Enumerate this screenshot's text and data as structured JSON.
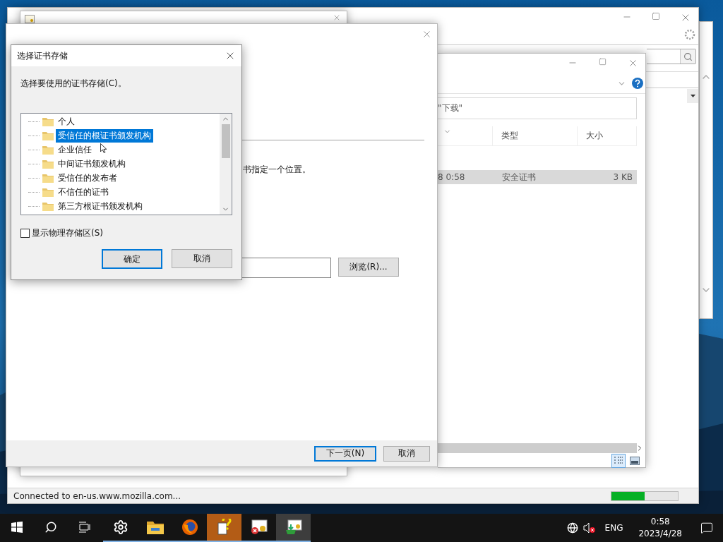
{
  "browser_window": {
    "status_text": "Connected to en-us.www.mozilla.com...",
    "progress": {
      "level": 0.5
    }
  },
  "explorer_window": {
    "search": {
      "value": "\"下载\""
    },
    "columns": [
      {
        "sorted": true
      },
      {
        "label": "类型"
      },
      {
        "label": "大小"
      }
    ],
    "rows": [
      {
        "cells": [
          "8 0:58",
          "安全证书",
          "3 KB"
        ],
        "selected": true
      }
    ]
  },
  "import_wizard": {
    "instruction": "书指定一个位置。",
    "browse_button": "浏览(R)...",
    "next_button": "下一页(N)",
    "cancel_button": "取消"
  },
  "store_dialog": {
    "title": "选择证书存储",
    "prompt": "选择要使用的证书存储(C)。",
    "stores": [
      {
        "label": "个人",
        "selected": false
      },
      {
        "label": "受信任的根证书颁发机构",
        "selected": true
      },
      {
        "label": "企业信任",
        "selected": false
      },
      {
        "label": "中间证书颁发机构",
        "selected": false
      },
      {
        "label": "受信任的发布者",
        "selected": false
      },
      {
        "label": "不信任的证书",
        "selected": false
      },
      {
        "label": "第三方根证书颁发机构",
        "selected": false
      }
    ],
    "show_physical": {
      "label": "显示物理存储区(S)",
      "checked": false
    },
    "ok_button": "确定",
    "cancel_button": "取消"
  },
  "taskbar": {
    "apps": [
      {
        "kind": "settings",
        "running": true,
        "selected": false,
        "flashing": false
      },
      {
        "kind": "folder",
        "running": true,
        "selected": false,
        "flashing": false
      },
      {
        "kind": "firefox",
        "running": true,
        "selected": false,
        "flashing": false
      },
      {
        "kind": "help",
        "running": true,
        "selected": false,
        "flashing": true
      },
      {
        "kind": "certificate",
        "running": true,
        "selected": false,
        "flashing": false
      },
      {
        "kind": "installer",
        "running": true,
        "selected": true,
        "flashing": false
      }
    ],
    "language": "ENG",
    "time": "0:58",
    "date": "2023/4/28"
  }
}
